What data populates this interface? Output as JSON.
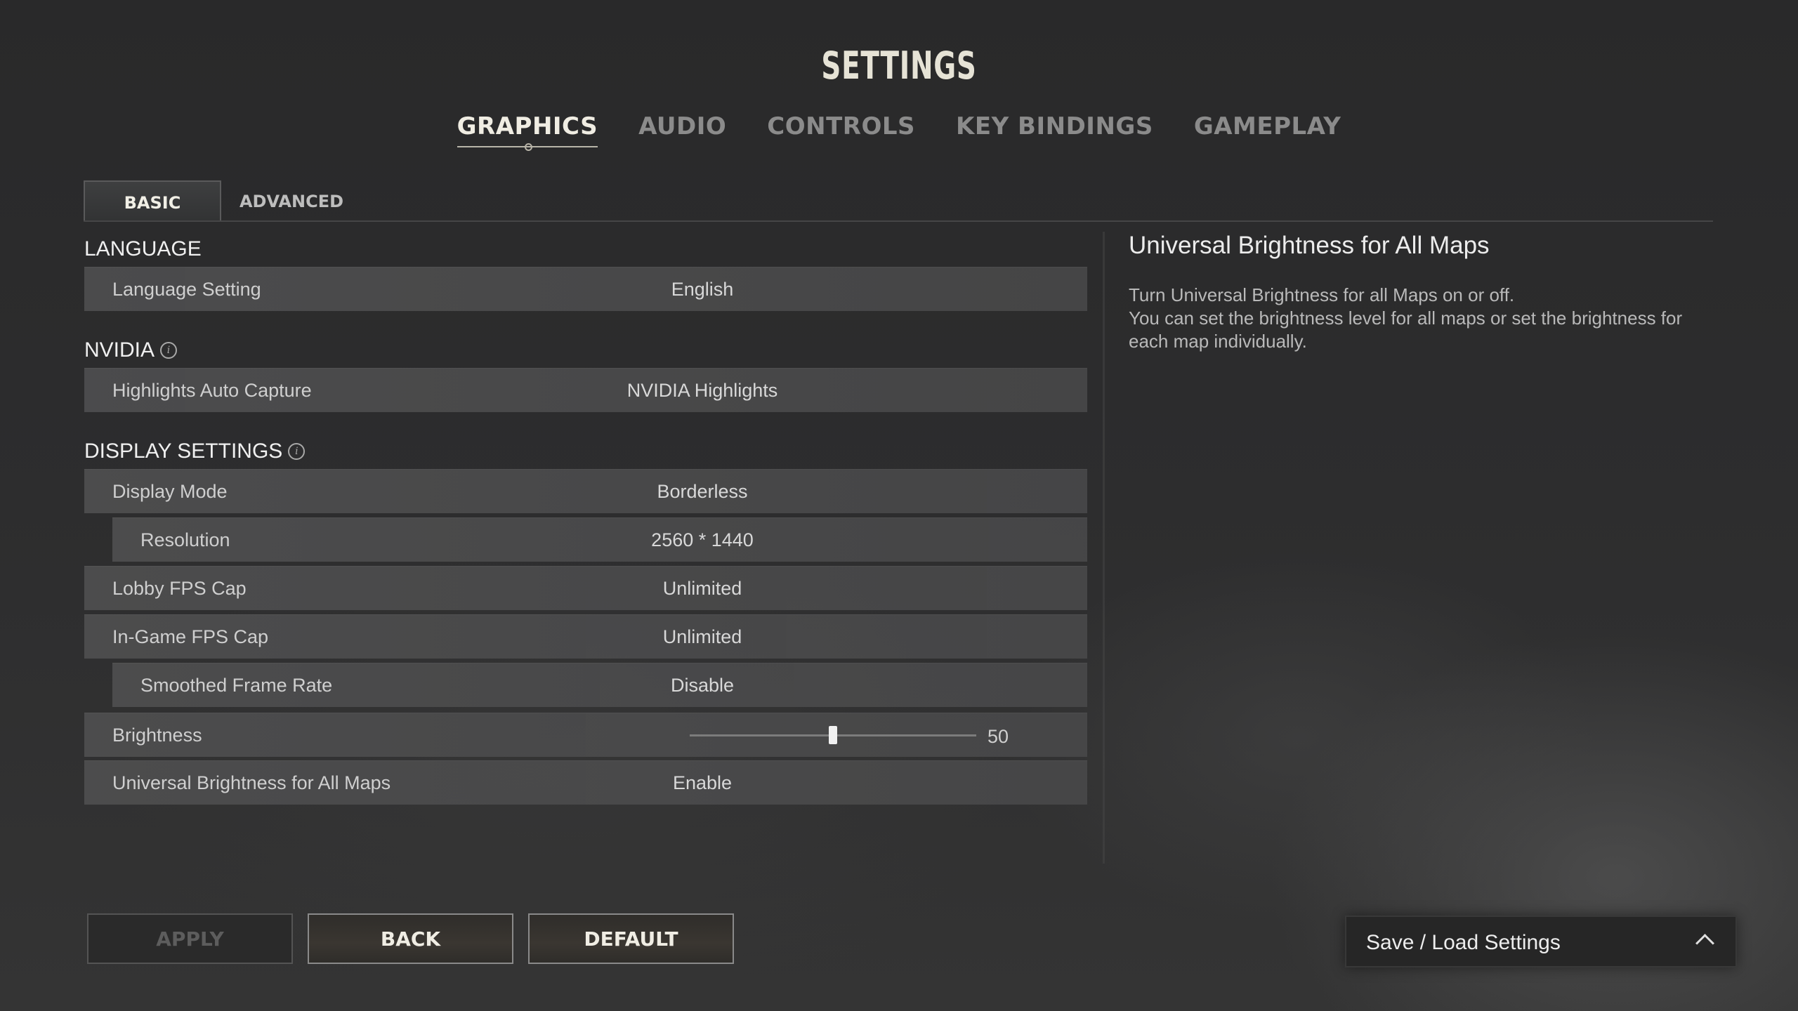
{
  "title": "SETTINGS",
  "top_tabs": [
    {
      "label": "GRAPHICS",
      "active": true
    },
    {
      "label": "AUDIO",
      "active": false
    },
    {
      "label": "CONTROLS",
      "active": false
    },
    {
      "label": "KEY BINDINGS",
      "active": false
    },
    {
      "label": "GAMEPLAY",
      "active": false
    }
  ],
  "sub_tabs": {
    "basic": "BASIC",
    "advanced": "ADVANCED",
    "active": "BASIC"
  },
  "sections": {
    "language": {
      "title": "LANGUAGE",
      "rows": [
        {
          "label": "Language Setting",
          "value": "English"
        }
      ]
    },
    "nvidia": {
      "title": "NVIDIA",
      "rows": [
        {
          "label": "Highlights Auto Capture",
          "value": "NVIDIA Highlights"
        }
      ]
    },
    "display": {
      "title": "DISPLAY SETTINGS",
      "rows": [
        {
          "label": "Display Mode",
          "value": "Borderless"
        },
        {
          "label": "Resolution",
          "value": "2560 * 1440"
        },
        {
          "label": "Lobby FPS Cap",
          "value": "Unlimited"
        },
        {
          "label": "In-Game FPS Cap",
          "value": "Unlimited"
        },
        {
          "label": "Smoothed Frame Rate",
          "value": "Disable"
        },
        {
          "label": "Brightness",
          "value": "50"
        },
        {
          "label": "Universal Brightness for All Maps",
          "value": "Enable"
        }
      ]
    }
  },
  "brightness_slider": {
    "min": 0,
    "max": 100,
    "value": 50
  },
  "description": {
    "title": "Universal Brightness for All Maps",
    "lines": [
      "Turn Universal Brightness for all Maps on or off.",
      "You can set the brightness level for all maps or set the brightness for",
      "each map individually."
    ]
  },
  "buttons": {
    "apply": "APPLY",
    "back": "BACK",
    "default": "DEFAULT",
    "apply_enabled": false
  },
  "save_load": {
    "label": "Save / Load Settings"
  },
  "icons": {
    "info": "info-icon",
    "chevron": "chevron-up-icon"
  },
  "colors": {
    "background": "#2b2b2c",
    "row": "#4d4d4e",
    "active_text": "#f0ede3",
    "inactive_tab": "#8b8b8b"
  }
}
